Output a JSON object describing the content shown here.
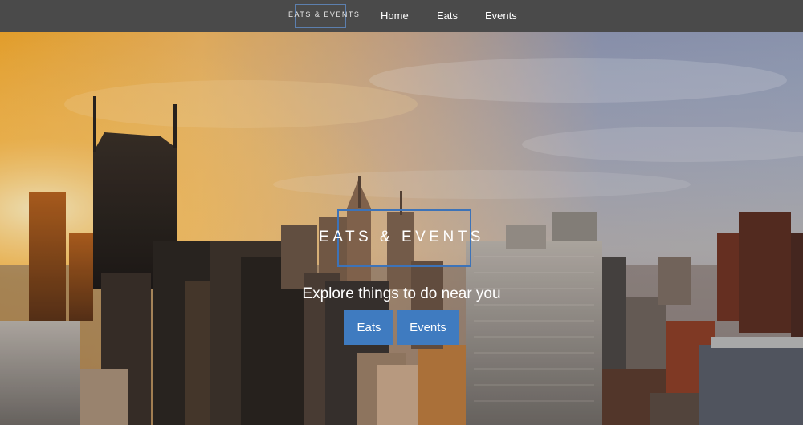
{
  "navbar": {
    "brand": "EATS & EVENTS",
    "links": [
      {
        "label": "Home"
      },
      {
        "label": "Eats"
      },
      {
        "label": "Events"
      }
    ]
  },
  "hero": {
    "title": "EATS & EVENTS",
    "subtitle": "Explore things to do near you",
    "buttons": [
      {
        "label": "Eats"
      },
      {
        "label": "Events"
      }
    ],
    "background": "city-skyline-sunset-photo"
  },
  "colors": {
    "navbar_bg": "#4a4a4a",
    "accent": "#3f7bc0",
    "border_accent": "#3d73b8"
  }
}
